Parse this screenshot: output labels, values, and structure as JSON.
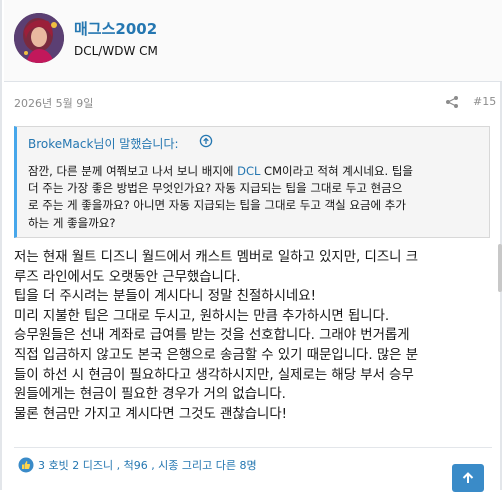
{
  "user": {
    "name": "매그스2002",
    "title": "DCL/WDW CM"
  },
  "meta": {
    "date": "2026년 5월 9일",
    "post_number": "#15"
  },
  "quote": {
    "author_line": "BrokeMack님이 말했습니다:",
    "line1_a": "잠깐, 다른 분께 여쭤보고 나서 보니 배지에 ",
    "line1_accent": "DCL",
    "line1_b": " CM이라고 적혀 계시네요. 팁을",
    "line2": "더 주는 가장 좋은 방법은 무엇인가요? 자동 지급되는 팁을 그대로 두고 현금으",
    "line3": "로 주는 게 좋을까요? 아니면 자동 지급되는 팁을 그대로 두고 객실 요금에 추가",
    "line4": "하는 게 좋을까요?"
  },
  "body": {
    "lines": [
      "저는 현재 월트 디즈니 월드에서 캐스트 멤버로 일하고 있지만, 디즈니 크",
      "루즈 라인에서도 오랫동안 근무했습니다.",
      "팁을 더 주시려는 분들이 계시다니 정말 친절하시네요!",
      "미리 지불한 팁은 그대로 두시고, 원하시는 만큼 추가하시면 됩니다.",
      "승무원들은 선내 계좌로 급여를 받는 것을 선호합니다. 그래야 번거롭게",
      "직접 입금하지 않고도 본국 은행으로 송금할 수 있기 때문입니다. 많은 분",
      "들이 하선 시 현금이 필요하다고 생각하시지만, 실제로는 해당 부서 승무",
      "원들에게는 현금이 필요한 경우가 거의 없습니다.",
      "물론 현금만 가지고 계시다면 그것도 괜찮습니다!"
    ]
  },
  "reactions": {
    "text": "3 호빗 2 디즈니 , 척96 , 시종 그리고 다른 8명"
  },
  "icons": {
    "share": "share-icon",
    "quote_jump": "arrow-up-circle-icon",
    "like": "thumbs-up-icon",
    "scroll_top": "arrow-up-icon"
  },
  "colors": {
    "link": "#2577b1",
    "quote_border": "#47a7eb",
    "scroll_button": "#3a8bc8",
    "like": "#f5a623"
  }
}
